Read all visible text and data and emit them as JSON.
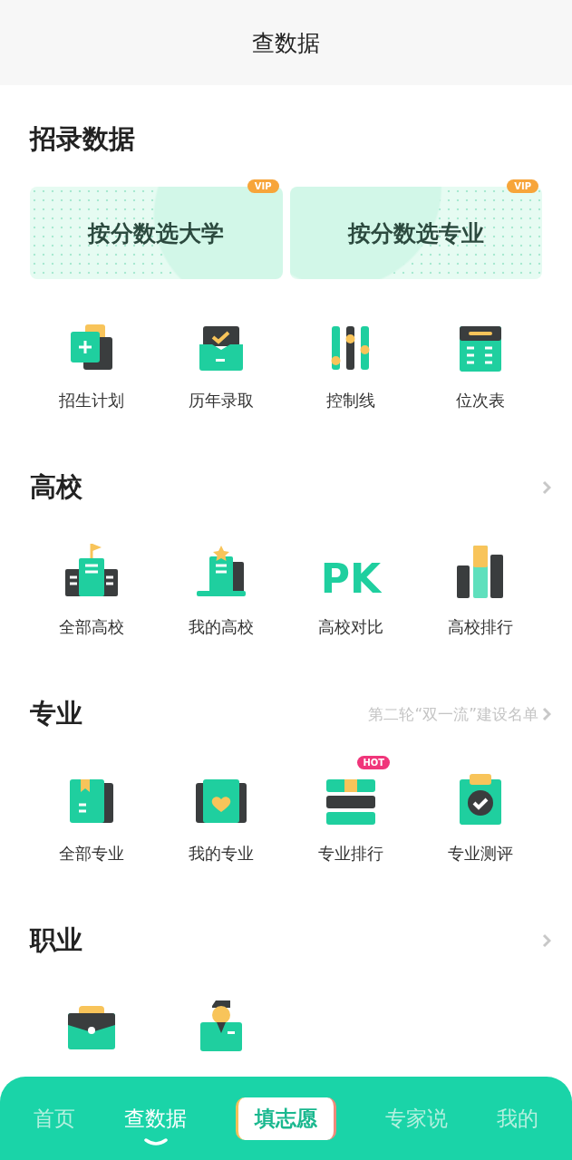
{
  "header": {
    "title": "查数据"
  },
  "sections": [
    {
      "title": "招录数据",
      "more": false,
      "banners": [
        {
          "label": "按分数选大学",
          "badge": "VIP"
        },
        {
          "label": "按分数选专业",
          "badge": "VIP"
        }
      ],
      "items": [
        {
          "kind": "labeled",
          "label": "招生计划"
        },
        {
          "kind": "labeled",
          "label": "历年录取"
        },
        {
          "kind": "labeled",
          "label": "控制线"
        },
        {
          "kind": "labeled",
          "label": "位次表"
        }
      ]
    },
    {
      "title": "高校",
      "more": true,
      "items": [
        {
          "kind": "labeled",
          "label": "全部高校"
        },
        {
          "kind": "labeled",
          "label": "我的高校"
        },
        {
          "kind": "labeled",
          "label": "高校对比",
          "icon_text": "PK"
        },
        {
          "kind": "labeled",
          "label": "高校排行"
        }
      ]
    },
    {
      "title": "专业",
      "more": true,
      "link": "第二轮“双一流”建设名单",
      "items": [
        {
          "kind": "labeled",
          "label": "全部专业"
        },
        {
          "kind": "labeled",
          "label": "我的专业"
        },
        {
          "kind": "labeled",
          "label": "专业排行",
          "badge": "HOT"
        },
        {
          "kind": "labeled",
          "label": "专业测评"
        }
      ]
    },
    {
      "title": "职业",
      "more": true,
      "items": [
        {
          "kind": "icon"
        },
        {
          "kind": "icon"
        }
      ]
    }
  ],
  "tabs": [
    {
      "label": "首页",
      "kind": "tab",
      "selected": false
    },
    {
      "label": "查数据",
      "kind": "tab",
      "selected": true
    },
    {
      "label": "填志愿",
      "kind": "center",
      "selected": false
    },
    {
      "label": "专家说",
      "kind": "tab",
      "selected": false
    },
    {
      "label": "我的",
      "kind": "tab",
      "selected": false
    }
  ]
}
